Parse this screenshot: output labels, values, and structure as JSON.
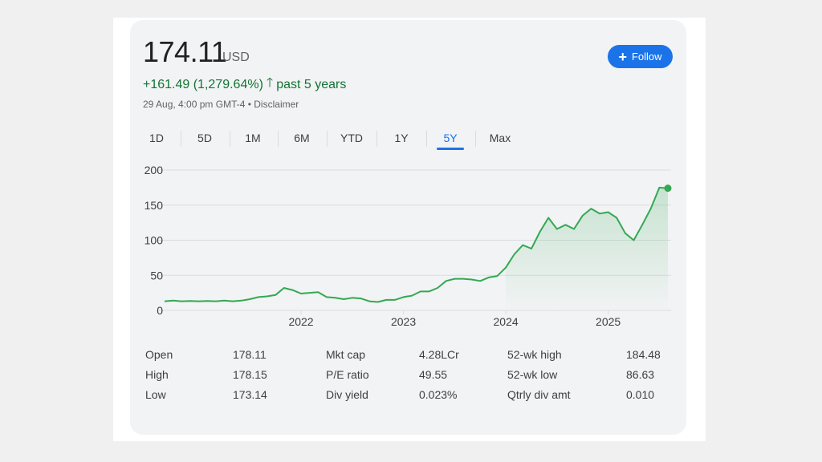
{
  "header": {
    "price": "174.11",
    "currency": "USD",
    "change": "+161.49 (1,279.64%)",
    "period": "past 5 years",
    "timestamp": "29 Aug, 4:00 pm GMT-4 • Disclaimer",
    "follow_label": "Follow"
  },
  "tabs": [
    "1D",
    "5D",
    "1M",
    "6M",
    "YTD",
    "1Y",
    "5Y",
    "Max"
  ],
  "active_tab": "5Y",
  "colors": {
    "line": "#34a853",
    "accent": "#1a73e8",
    "positive": "#137333"
  },
  "chart_data": {
    "type": "area",
    "x_ticks": [
      "2022",
      "2023",
      "2024",
      "2025"
    ],
    "y_ticks": [
      "0",
      "50",
      "100",
      "150",
      "200"
    ],
    "ylim": [
      0,
      200
    ],
    "grid": true,
    "x": [
      "2020-09",
      "2020-10",
      "2020-11",
      "2020-12",
      "2021-01",
      "2021-02",
      "2021-03",
      "2021-04",
      "2021-05",
      "2021-06",
      "2021-07",
      "2021-08",
      "2021-09",
      "2021-10",
      "2021-11",
      "2021-12",
      "2022-01",
      "2022-02",
      "2022-03",
      "2022-04",
      "2022-05",
      "2022-06",
      "2022-07",
      "2022-08",
      "2022-09",
      "2022-10",
      "2022-11",
      "2022-12",
      "2023-01",
      "2023-02",
      "2023-03",
      "2023-04",
      "2023-05",
      "2023-06",
      "2023-07",
      "2023-08",
      "2023-09",
      "2023-10",
      "2023-11",
      "2023-12",
      "2024-01",
      "2024-02",
      "2024-03",
      "2024-04",
      "2024-05",
      "2024-06",
      "2024-07",
      "2024-08",
      "2024-09",
      "2024-10",
      "2024-11",
      "2024-12",
      "2025-01",
      "2025-02",
      "2025-03",
      "2025-04",
      "2025-05",
      "2025-06",
      "2025-07",
      "2025-08"
    ],
    "values": [
      13,
      14,
      13,
      13.5,
      13,
      13.5,
      13,
      14,
      13,
      14,
      16,
      19,
      20,
      22,
      32,
      29,
      24,
      25,
      26,
      19,
      18,
      16,
      18,
      17,
      13,
      12,
      15,
      15,
      19,
      21,
      27,
      27,
      32,
      42,
      45,
      45,
      44,
      42,
      47,
      49,
      61,
      80,
      93,
      88,
      112,
      132,
      116,
      122,
      116,
      135,
      145,
      138,
      140,
      132,
      110,
      100,
      122,
      145,
      175,
      174.11
    ]
  },
  "stats": [
    {
      "label": "Open",
      "value": "178.11"
    },
    {
      "label": "High",
      "value": "178.15"
    },
    {
      "label": "Low",
      "value": "173.14"
    },
    {
      "label": "Mkt cap",
      "value": "4.28LCr"
    },
    {
      "label": "P/E ratio",
      "value": "49.55"
    },
    {
      "label": "Div yield",
      "value": "0.023%"
    },
    {
      "label": "52-wk high",
      "value": "184.48"
    },
    {
      "label": "52-wk low",
      "value": "86.63"
    },
    {
      "label": "Qtrly div amt",
      "value": "0.010"
    }
  ]
}
